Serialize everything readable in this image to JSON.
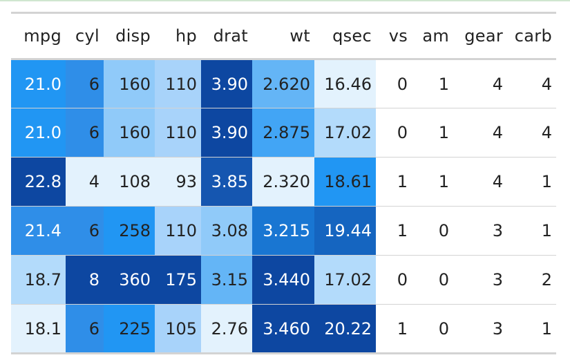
{
  "table": {
    "columns": [
      "mpg",
      "cyl",
      "disp",
      "hp",
      "drat",
      "wt",
      "qsec",
      "vs",
      "am",
      "gear",
      "carb"
    ],
    "rows": [
      [
        "21.0",
        "6",
        "160",
        "110",
        "3.90",
        "2.620",
        "16.46",
        "0",
        "1",
        "4",
        "4"
      ],
      [
        "21.0",
        "6",
        "160",
        "110",
        "3.90",
        "2.875",
        "17.02",
        "0",
        "1",
        "4",
        "4"
      ],
      [
        "22.8",
        "4",
        "108",
        "93",
        "3.85",
        "2.320",
        "18.61",
        "1",
        "1",
        "4",
        "1"
      ],
      [
        "21.4",
        "6",
        "258",
        "110",
        "3.08",
        "3.215",
        "19.44",
        "1",
        "0",
        "3",
        "1"
      ],
      [
        "18.7",
        "8",
        "360",
        "175",
        "3.15",
        "3.440",
        "17.02",
        "0",
        "0",
        "3",
        "2"
      ],
      [
        "18.1",
        "6",
        "225",
        "105",
        "2.76",
        "3.460",
        "20.22",
        "1",
        "0",
        "3",
        "1"
      ]
    ],
    "cell_colors": [
      [
        "#2196f3",
        "#2f8ee8",
        "#90caf9",
        "#a8d3fa",
        "#0d47a1",
        "#64b5f6",
        "#e3f2fd",
        "",
        "",
        "",
        ""
      ],
      [
        "#2196f3",
        "#2f8ee8",
        "#90caf9",
        "#a8d3fa",
        "#0d47a1",
        "#42a5f5",
        "#b3dbfb",
        "",
        "",
        "",
        ""
      ],
      [
        "#0d47a1",
        "#e3f2fd",
        "#e3f2fd",
        "#e3f2fd",
        "#1556b0",
        "#e3f2fd",
        "#2196f3",
        "",
        "",
        "",
        ""
      ],
      [
        "#2f8ee8",
        "#2f8ee8",
        "#2196f3",
        "#a8d3fa",
        "#90caf9",
        "#1976d2",
        "#1565c0",
        "",
        "",
        "",
        ""
      ],
      [
        "#b3dbfb",
        "#0d47a1",
        "#0d47a1",
        "#0d47a1",
        "#64b5f6",
        "#0d47a1",
        "#b3dbfb",
        "",
        "",
        "",
        ""
      ],
      [
        "#e3f2fd",
        "#2f8ee8",
        "#2196f3",
        "#a8d3fa",
        "#e3f2fd",
        "#0d47a1",
        "#0d47a1",
        "",
        "",
        "",
        ""
      ]
    ],
    "text_colors": [
      [
        "#ffffff",
        "#222222",
        "#222222",
        "#222222",
        "#ffffff",
        "#222222",
        "#222222",
        "#222222",
        "#222222",
        "#222222",
        "#222222"
      ],
      [
        "#ffffff",
        "#222222",
        "#222222",
        "#222222",
        "#ffffff",
        "#222222",
        "#222222",
        "#222222",
        "#222222",
        "#222222",
        "#222222"
      ],
      [
        "#ffffff",
        "#222222",
        "#222222",
        "#222222",
        "#ffffff",
        "#222222",
        "#222222",
        "#222222",
        "#222222",
        "#222222",
        "#222222"
      ],
      [
        "#ffffff",
        "#222222",
        "#222222",
        "#222222",
        "#222222",
        "#ffffff",
        "#ffffff",
        "#222222",
        "#222222",
        "#222222",
        "#222222"
      ],
      [
        "#222222",
        "#ffffff",
        "#ffffff",
        "#ffffff",
        "#222222",
        "#ffffff",
        "#222222",
        "#222222",
        "#222222",
        "#222222",
        "#222222"
      ],
      [
        "#222222",
        "#222222",
        "#222222",
        "#222222",
        "#222222",
        "#ffffff",
        "#ffffff",
        "#222222",
        "#222222",
        "#222222",
        "#222222"
      ]
    ]
  }
}
